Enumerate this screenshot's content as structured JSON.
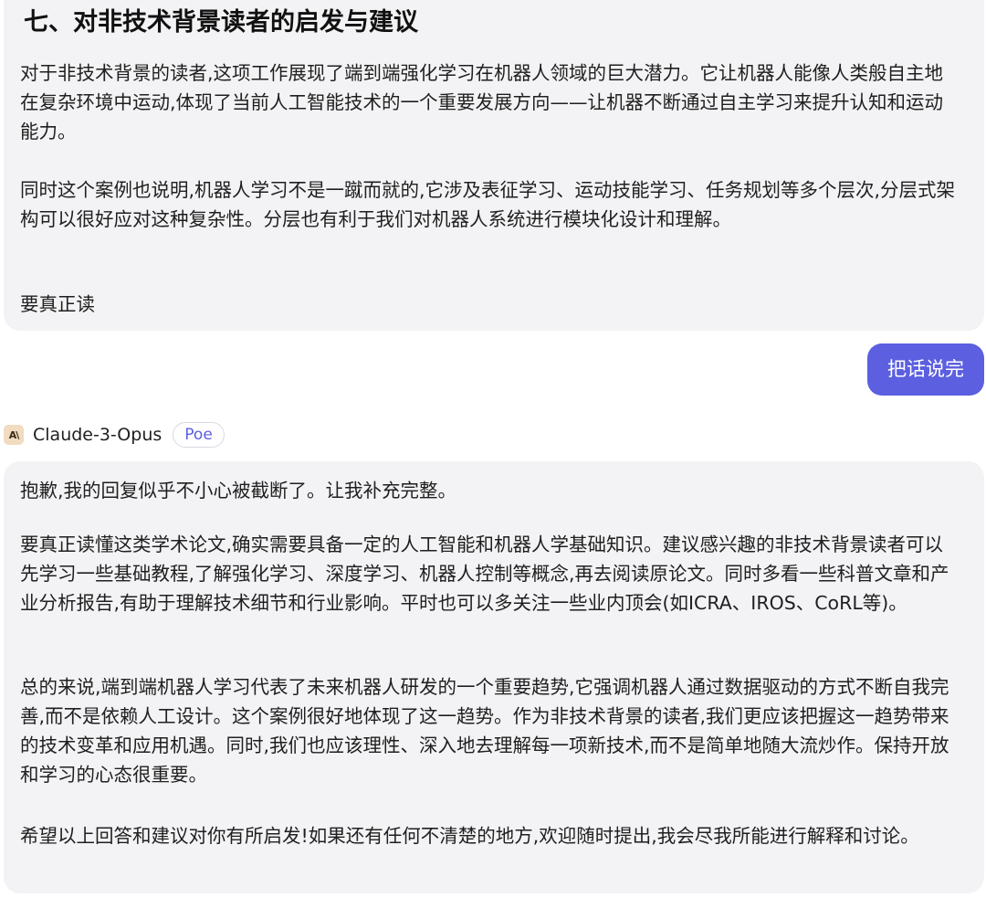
{
  "message1": {
    "heading": "七、对非技术背景读者的启发与建议",
    "paragraphs": [
      "对于非技术背景的读者,这项工作展现了端到端强化学习在机器人领域的巨大潜力。它让机器人能像人类般自主地在复杂环境中运动,体现了当前人工智能技术的一个重要发展方向——让机器不断通过自主学习来提升认知和运动能力。",
      "同时这个案例也说明,机器人学习不是一蹴而就的,它涉及表征学习、运动技能学习、任务规划等多个层次,分层式架构可以很好应对这种复杂性。分层也有利于我们对机器人系统进行模块化设计和理解。",
      "要真正读"
    ]
  },
  "user_message": {
    "text": "把话说完"
  },
  "bot": {
    "avatar_text": "A\\",
    "name": "Claude-3-Opus",
    "badge": "Poe"
  },
  "message2": {
    "paragraphs": [
      "抱歉,我的回复似乎不小心被截断了。让我补充完整。",
      "要真正读懂这类学术论文,确实需要具备一定的人工智能和机器人学基础知识。建议感兴趣的非技术背景读者可以先学习一些基础教程,了解强化学习、深度学习、机器人控制等概念,再去阅读原论文。同时多看一些科普文章和产业分析报告,有助于理解技术细节和行业影响。平时也可以多关注一些业内顶会(如ICRA、IROS、CoRL等)。",
      "总的来说,端到端机器人学习代表了未来机器人研发的一个重要趋势,它强调机器人通过数据驱动的方式不断自我完善,而不是依赖人工设计。这个案例很好地体现了这一趋势。作为非技术背景的读者,我们更应该把握这一趋势带来的技术变革和应用机遇。同时,我们也应该理性、深入地去理解每一项新技术,而不是简单地随大流炒作。保持开放和学习的心态很重要。",
      "希望以上回答和建议对你有所启发!如果还有任何不清楚的地方,欢迎随时提出,我会尽我所能进行解释和讨论。"
    ]
  },
  "colors": {
    "accent": "#5b5fe0",
    "bubble_bg": "#f3f3f5"
  }
}
